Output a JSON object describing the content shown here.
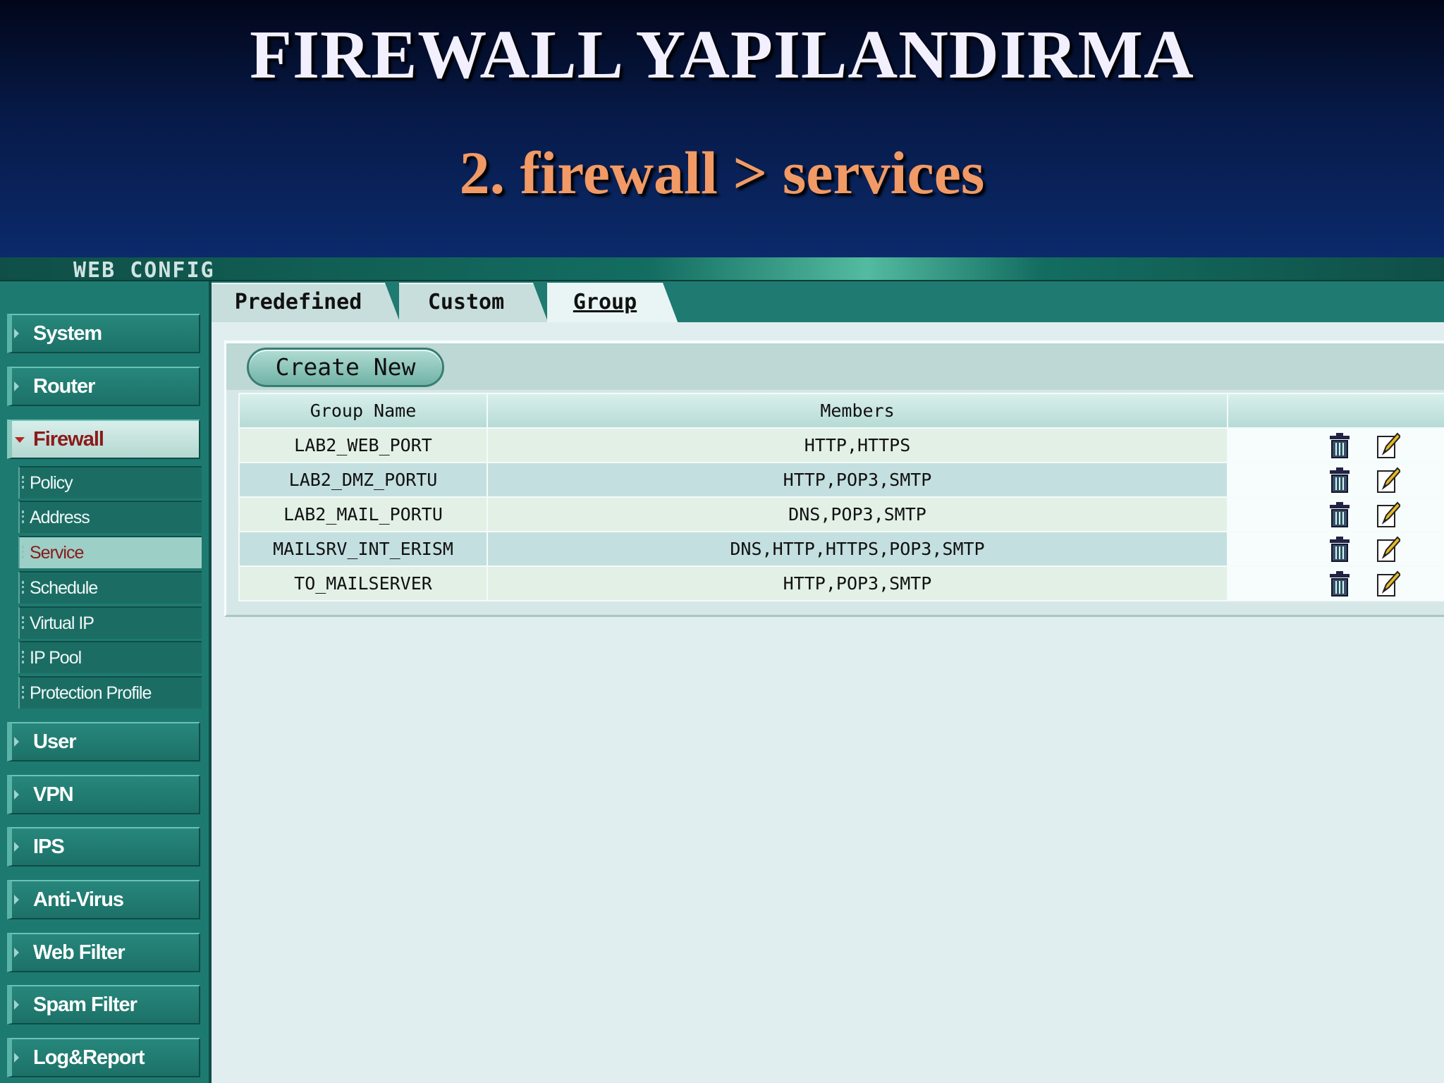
{
  "slide": {
    "title": "FIREWALL YAPILANDIRMA",
    "subtitle": "2. firewall > services"
  },
  "app": {
    "header_label": "WEB CONFIG"
  },
  "sidebar": {
    "items": [
      {
        "label": "System"
      },
      {
        "label": "Router"
      },
      {
        "label": "Firewall",
        "expanded": true,
        "subitems": [
          {
            "label": "Policy"
          },
          {
            "label": "Address"
          },
          {
            "label": "Service",
            "active": true
          },
          {
            "label": "Schedule"
          },
          {
            "label": "Virtual IP"
          },
          {
            "label": "IP Pool"
          },
          {
            "label": "Protection Profile"
          }
        ]
      },
      {
        "label": "User"
      },
      {
        "label": "VPN"
      },
      {
        "label": "IPS"
      },
      {
        "label": "Anti-Virus"
      },
      {
        "label": "Web Filter"
      },
      {
        "label": "Spam Filter"
      },
      {
        "label": "Log&Report"
      }
    ]
  },
  "tabs": [
    {
      "label": "Predefined"
    },
    {
      "label": "Custom"
    },
    {
      "label": "Group",
      "active": true
    }
  ],
  "toolbar": {
    "create_new_label": "Create New"
  },
  "table": {
    "headers": [
      "Group Name",
      "Members",
      ""
    ],
    "rows": [
      {
        "group_name": "LAB2_WEB_PORT",
        "members": "HTTP,HTTPS"
      },
      {
        "group_name": "LAB2_DMZ_PORTU",
        "members": "HTTP,POP3,SMTP"
      },
      {
        "group_name": "LAB2_MAIL_PORTU",
        "members": "DNS,POP3,SMTP"
      },
      {
        "group_name": "MAILSRV_INT_ERISM",
        "members": "DNS,HTTP,HTTPS,POP3,SMTP"
      },
      {
        "group_name": "TO_MAILSERVER",
        "members": "HTTP,POP3,SMTP"
      }
    ],
    "row_actions": [
      "trash-icon",
      "edit-icon"
    ]
  },
  "colors": {
    "sidebar_bg": "#1d7a70",
    "active_item_text": "#8b1a1a",
    "subtitle": "#f19a66",
    "header_bg": "#071a48"
  }
}
